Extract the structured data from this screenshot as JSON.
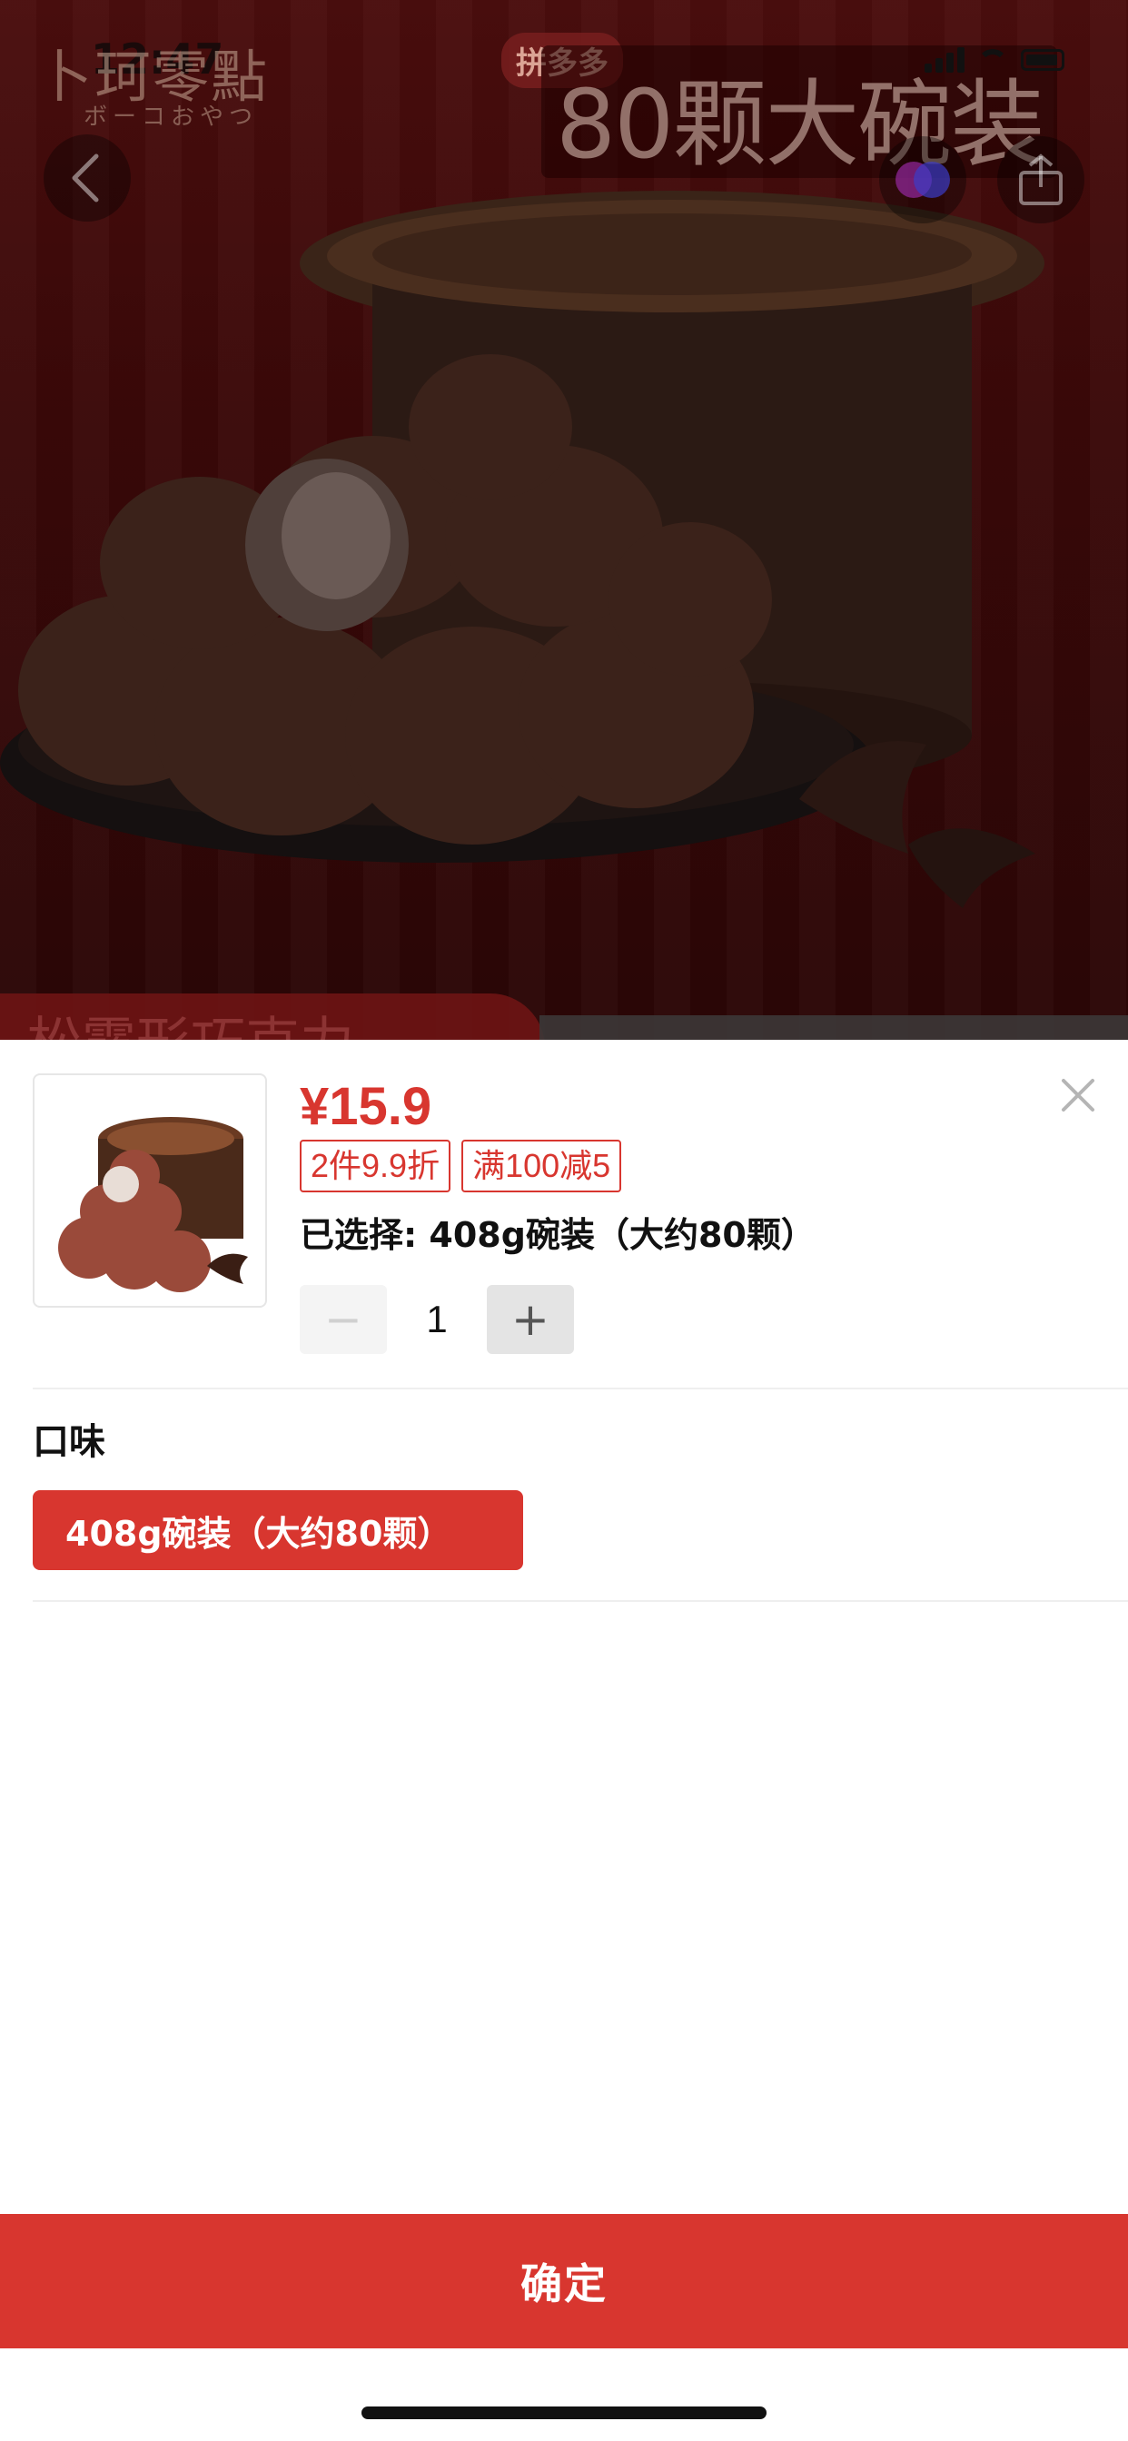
{
  "status_bar": {
    "time": "12:47"
  },
  "background_page": {
    "brand_logo": "卜珂零點",
    "brand_sub": "ボーコおやつ",
    "platform_badge": "拼多多",
    "banner_text": "80颗大碗装",
    "bottom_strip_text": "松露形巧克力"
  },
  "sku_sheet": {
    "price": "¥15.9",
    "tags": [
      "2件9.9折",
      "满100减5"
    ],
    "selected": "已选择: 408g碗装（大约80颗）",
    "quantity": "1",
    "minus_label": "−",
    "plus_label": "+",
    "option_group_title": "口味",
    "options": [
      {
        "label": "408g碗装（大约80颗）",
        "selected": true
      }
    ],
    "confirm_label": "确定"
  },
  "icons": {
    "back": "chevron-left-icon",
    "favorite": "favorite-icon",
    "share": "share-icon",
    "close": "close-icon"
  },
  "colors": {
    "accent": "#d8362f",
    "overlay_bg": "#3a0808"
  }
}
